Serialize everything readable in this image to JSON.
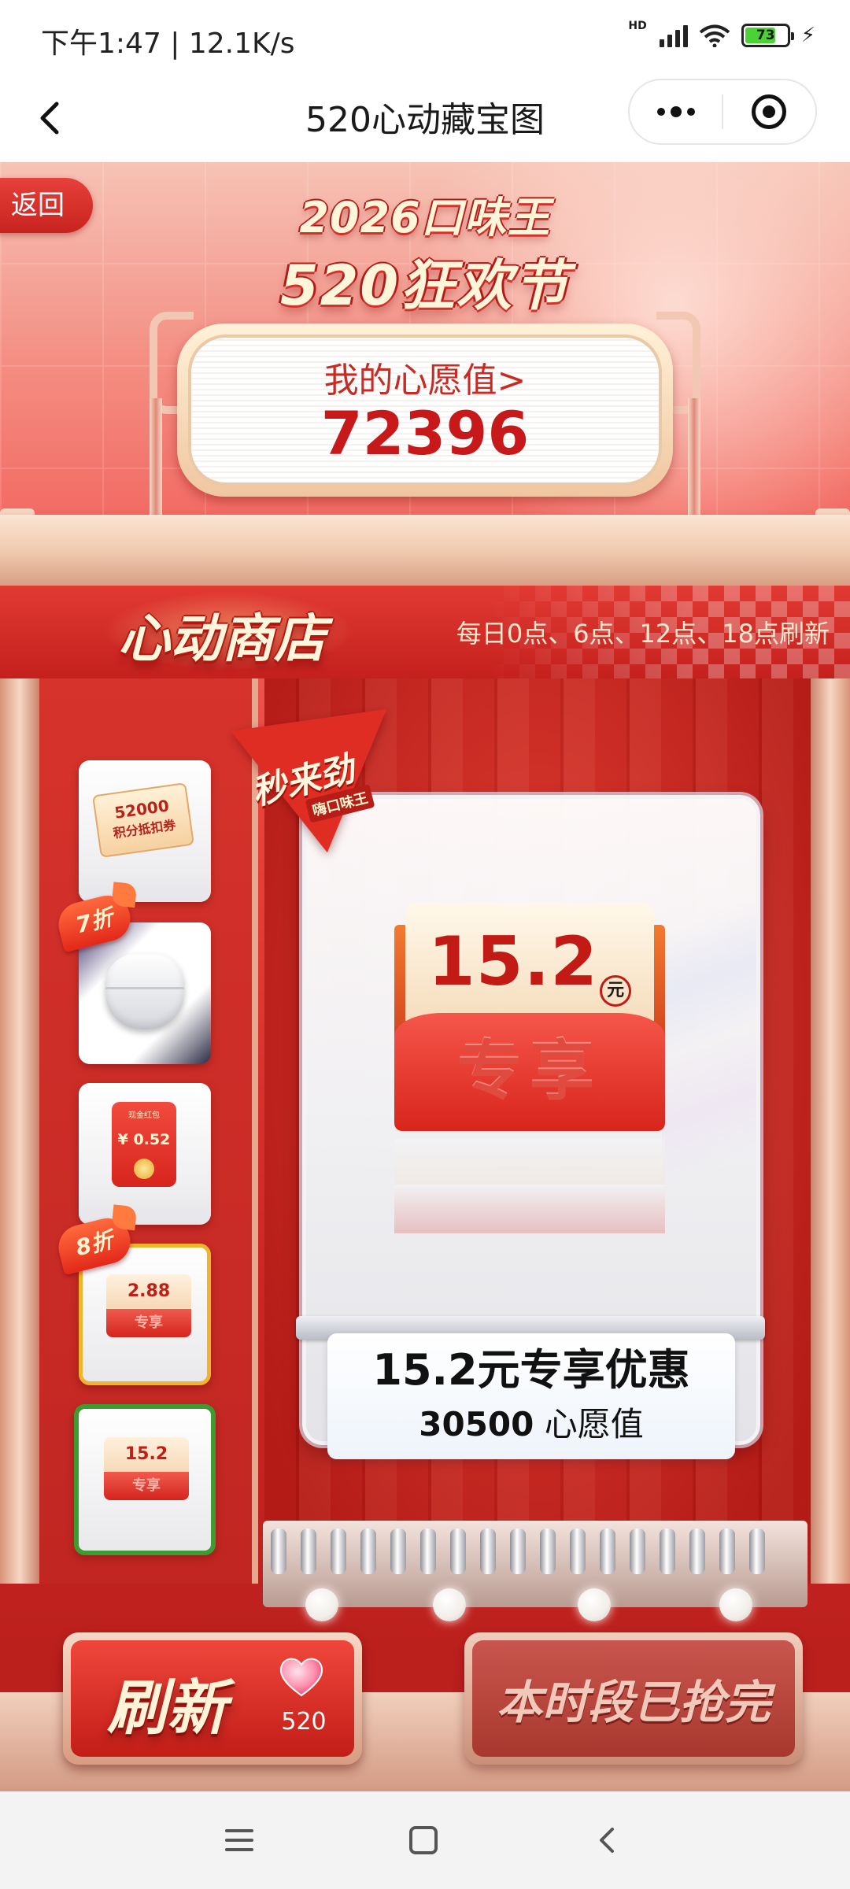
{
  "status_bar": {
    "time_speed": "下午1:47 | 12.1K/s",
    "network_label": "HD",
    "wifi_label": "6",
    "battery_level": "73"
  },
  "nav": {
    "title": "520心动藏宝图"
  },
  "event": {
    "return_label": "返回",
    "logo_line1": "2026口味王",
    "logo_line2": "520狂欢节",
    "wish_label": "我的心愿值>",
    "wish_value": "72396"
  },
  "shop": {
    "title": "心动商店",
    "refresh_note": "每日0点、6点、12点、18点刷新",
    "thumbnails": [
      {
        "amount": "52000",
        "label": "积分抵扣券"
      },
      {
        "badge": "7折"
      },
      {
        "envelope_top": "现金红包",
        "amount": "¥ 0.52"
      },
      {
        "badge": "8折",
        "amount": "2.88",
        "label": "专享"
      },
      {
        "amount": "15.2",
        "label": "专享"
      }
    ],
    "flash_tag": {
      "line1": "秒来劲",
      "line2": "嗨口味王"
    },
    "featured": {
      "amount": "15.2",
      "unit": "元",
      "label": "专享",
      "name": "15.2元专享优惠",
      "cost_value": "30500",
      "cost_unit": "心愿值"
    }
  },
  "actions": {
    "refresh_label": "刷新",
    "refresh_cost": "520",
    "soldout_label": "本时段已抢完"
  },
  "colors": {
    "brand_red": "#c8191a",
    "selected_border": "#3e9b32",
    "badge_gold": "#f0b42c"
  }
}
